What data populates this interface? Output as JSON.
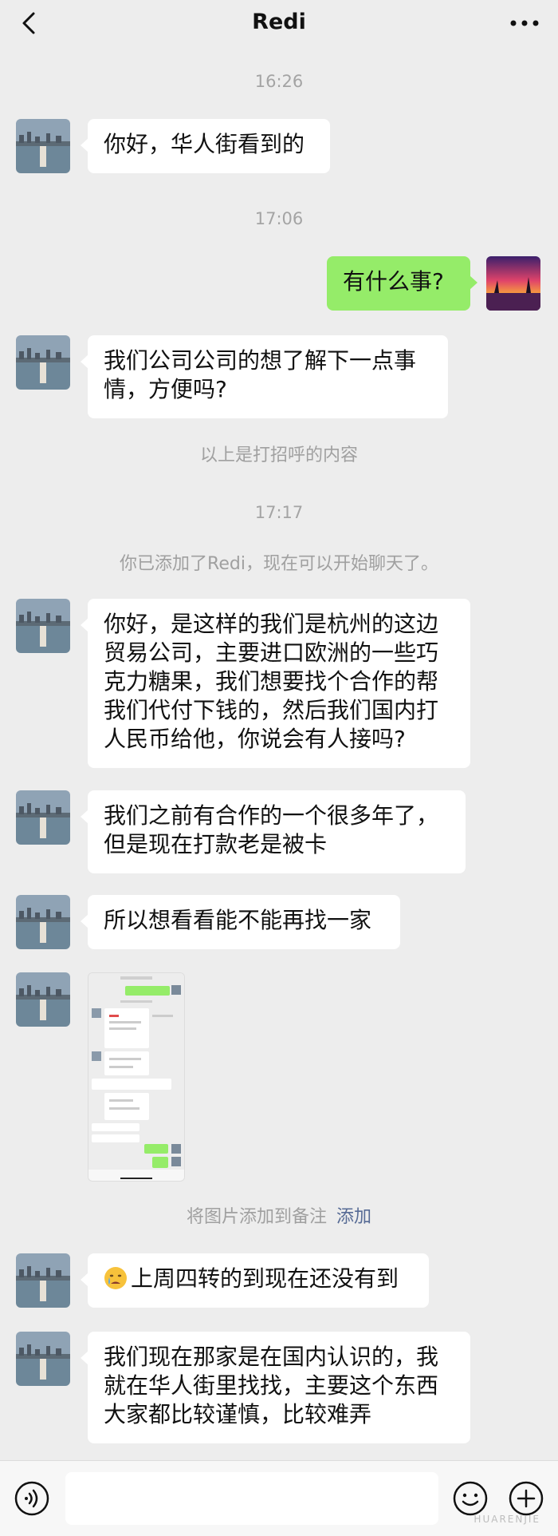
{
  "header": {
    "title": "Redi"
  },
  "timestamps": [
    "16:26",
    "17:06",
    "17:17"
  ],
  "system": {
    "greeting_note": "以上是打招呼的内容",
    "added_note": "你已添加了Redi，现在可以开始聊天了。",
    "image_note": "将图片添加到备注",
    "image_note_link": "添加"
  },
  "messages": [
    {
      "side": "left",
      "text": "你好，华人街看到的"
    },
    {
      "side": "right",
      "text": "有什么事?"
    },
    {
      "side": "left",
      "text": "我们公司公司的想了解下一点事情，方便吗?"
    },
    {
      "side": "left",
      "text": "你好，是这样的我们是杭州的这边贸易公司，主要进口欧洲的一些巧克力糖果，我们想要找个合作的帮我们代付下钱的，然后我们国内打人民币给他，你说会有人接吗?"
    },
    {
      "side": "left",
      "text": "我们之前有合作的一个很多年了，但是现在打款老是被卡"
    },
    {
      "side": "left",
      "text": "所以想看看能不能再找一家"
    },
    {
      "side": "left",
      "text": "上周四转的到现在还没有到"
    },
    {
      "side": "left",
      "text": "我们现在那家是在国内认识的，我就在华人街里找找，主要这个东西大家都比较谨慎，比较难弄"
    }
  ],
  "watermark": "HUARENJIE",
  "colors": {
    "background": "#ededed",
    "sent_bubble": "#95ec69",
    "received_bubble": "#ffffff",
    "link": "#576b95"
  },
  "icons": [
    "back-icon",
    "more-icon",
    "voice-icon",
    "emoji-icon",
    "plus-icon"
  ]
}
